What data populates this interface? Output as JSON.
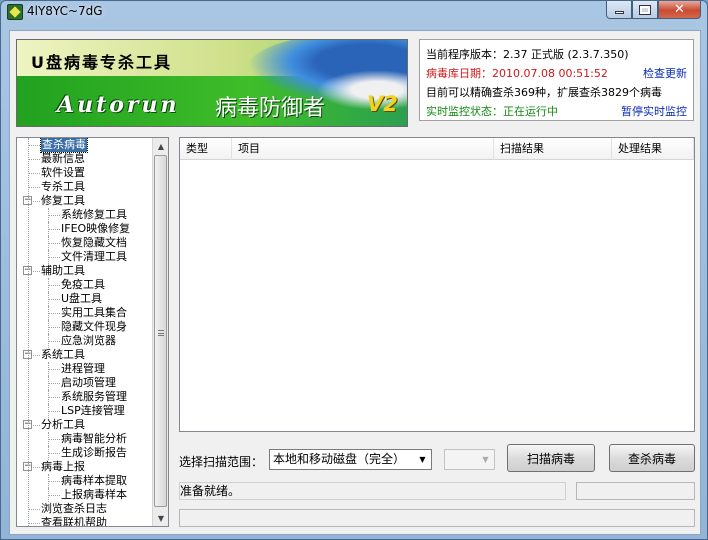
{
  "window": {
    "title": "4lY8YC~7dG",
    "close_glyph": "✕"
  },
  "banner": {
    "title": "U盘病毒专杀工具",
    "product": "Autorun",
    "subtitle": "病毒防御者",
    "version_badge": "V2"
  },
  "info": {
    "version_label": "当前程序版本：2.37 正式版 (2.3.7.350)",
    "db_date_label": "病毒库日期：",
    "db_date_value": "2010.07.08 00:51:52",
    "check_update": "检查更新",
    "capability": "目前可以精确查杀369种，扩展查杀3829个病毒",
    "monitor_label": "实时监控状态：",
    "monitor_value": "正在运行中",
    "pause_monitor": "暂停实时监控"
  },
  "tree": {
    "items": [
      {
        "label": "查杀病毒",
        "level": 0,
        "selected": true
      },
      {
        "label": "最新信息",
        "level": 0
      },
      {
        "label": "软件设置",
        "level": 0
      },
      {
        "label": "专杀工具",
        "level": 0
      },
      {
        "label": "修复工具",
        "level": 0,
        "toggle": "−"
      },
      {
        "label": "系统修复工具",
        "level": 1
      },
      {
        "label": "IFEO映像修复",
        "level": 1
      },
      {
        "label": "恢复隐藏文档",
        "level": 1
      },
      {
        "label": "文件清理工具",
        "level": 1
      },
      {
        "label": "辅助工具",
        "level": 0,
        "toggle": "−"
      },
      {
        "label": "免疫工具",
        "level": 1
      },
      {
        "label": "U盘工具",
        "level": 1
      },
      {
        "label": "实用工具集合",
        "level": 1
      },
      {
        "label": "隐藏文件现身",
        "level": 1
      },
      {
        "label": "应急浏览器",
        "level": 1
      },
      {
        "label": "系统工具",
        "level": 0,
        "toggle": "−"
      },
      {
        "label": "进程管理",
        "level": 1
      },
      {
        "label": "启动项管理",
        "level": 1
      },
      {
        "label": "系统服务管理",
        "level": 1
      },
      {
        "label": "LSP连接管理",
        "level": 1
      },
      {
        "label": "分析工具",
        "level": 0,
        "toggle": "−"
      },
      {
        "label": "病毒智能分析",
        "level": 1
      },
      {
        "label": "生成诊断报告",
        "level": 1
      },
      {
        "label": "病毒上报",
        "level": 0,
        "toggle": "−"
      },
      {
        "label": "病毒样本提取",
        "level": 1
      },
      {
        "label": "上报病毒样本",
        "level": 1
      },
      {
        "label": "浏览查杀日志",
        "level": 0
      },
      {
        "label": "查看联机帮助",
        "level": 0
      }
    ],
    "scroll_up": "▲",
    "scroll_down": "▼"
  },
  "list": {
    "columns": [
      "类型",
      "项目",
      "扫描结果",
      "处理结果"
    ]
  },
  "controls": {
    "scope_label": "选择扫描范围：",
    "scope_value": "本地和移动磁盘（完全）",
    "dropdown_arrow": "▼",
    "scan_button": "扫描病毒",
    "kill_button": "查杀病毒"
  },
  "status": {
    "text": "准备就绪。"
  }
}
